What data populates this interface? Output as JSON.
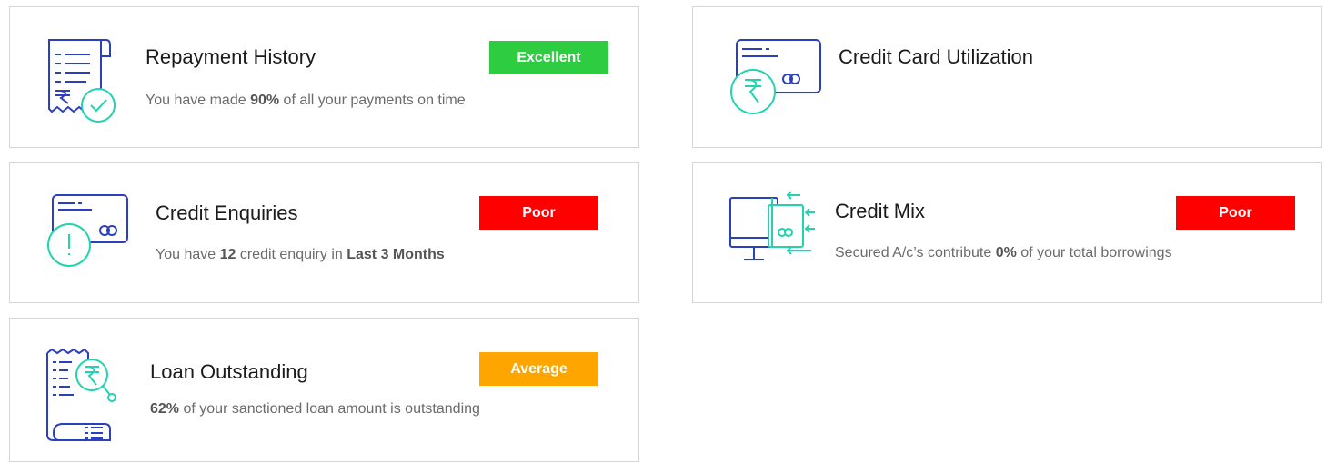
{
  "colors": {
    "icon_blue": "#2b3fbf",
    "icon_teal": "#22d3b0",
    "excellent": "#2ecc40",
    "poor": "#ff0000",
    "average": "#ffa500"
  },
  "cards": {
    "repayment": {
      "title": "Repayment History",
      "badge": "Excellent",
      "desc_before": "You have made ",
      "desc_bold": "90%",
      "desc_after": " of all your payments on time",
      "icon": "receipt-check-icon"
    },
    "utilization": {
      "title": "Credit Card Utilization",
      "icon": "card-rupee-icon"
    },
    "enquiries": {
      "title": "Credit Enquiries",
      "badge": "Poor",
      "desc_before": "You have ",
      "desc_bold": "12",
      "desc_mid": " credit enquiry in ",
      "desc_bold2": "Last 3 Months",
      "icon": "card-alert-icon"
    },
    "mix": {
      "title": "Credit Mix",
      "badge": "Poor",
      "desc_before": "Secured A/c’s contribute ",
      "desc_bold": "0%",
      "desc_after": " of your total borrowings",
      "icon": "monitor-card-icon"
    },
    "loan": {
      "title": "Loan Outstanding",
      "badge": "Average",
      "desc_bold": "62%",
      "desc_after": " of your sanctioned loan amount is outstanding",
      "icon": "document-search-icon"
    }
  }
}
